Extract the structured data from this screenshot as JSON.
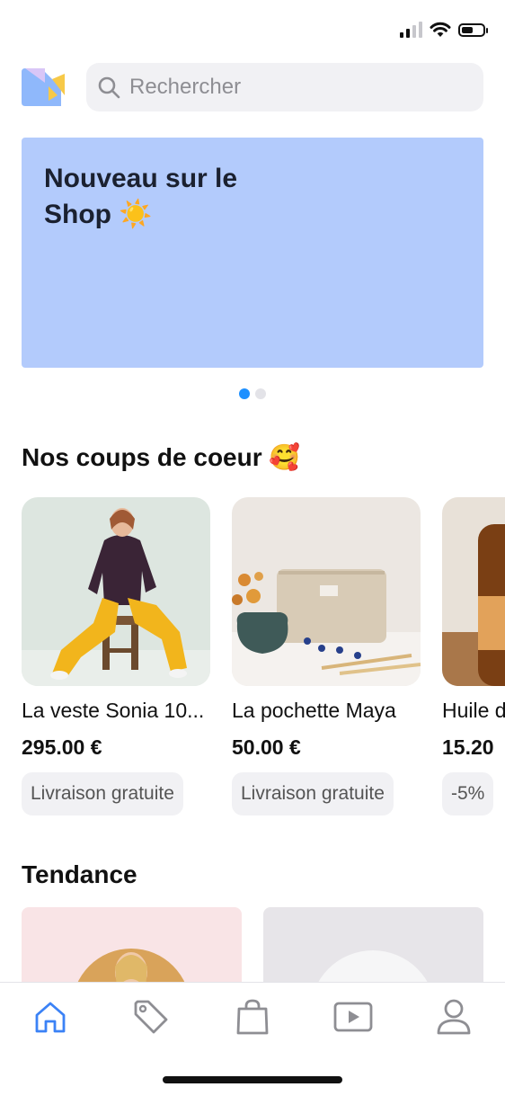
{
  "status_bar": {
    "signal_icon": "cellular-signal-icon",
    "wifi_icon": "wifi-icon",
    "battery_icon": "battery-icon",
    "battery_level": 0.55
  },
  "header": {
    "logo_icon": "app-logo",
    "search": {
      "placeholder": "Rechercher",
      "value": "",
      "icon": "search-icon"
    }
  },
  "banner": {
    "title": "Nouveau sur le Shop ☀️",
    "color": "#b3cbfc",
    "pages": 2,
    "active_page": 1
  },
  "favorites": {
    "title": "Nos coups de coeur 🥰",
    "items": [
      {
        "name": "La veste Sonia 10...",
        "price": "295.00 €",
        "tag": "Livraison gratuite"
      },
      {
        "name": "La pochette Maya",
        "price": "50.00 €",
        "tag": "Livraison gratuite"
      },
      {
        "name": "Huile d",
        "price": "15.20",
        "tag": "-5%"
      }
    ]
  },
  "trending": {
    "title": "Tendance"
  },
  "tab_bar": {
    "accent": "#3b82f6",
    "inactive": "#8e8e93",
    "tabs": [
      {
        "icon": "home-icon",
        "active": true
      },
      {
        "icon": "tag-icon",
        "active": false
      },
      {
        "icon": "shopping-bag-icon",
        "active": false
      },
      {
        "icon": "video-play-icon",
        "active": false
      },
      {
        "icon": "profile-icon",
        "active": false
      }
    ]
  }
}
